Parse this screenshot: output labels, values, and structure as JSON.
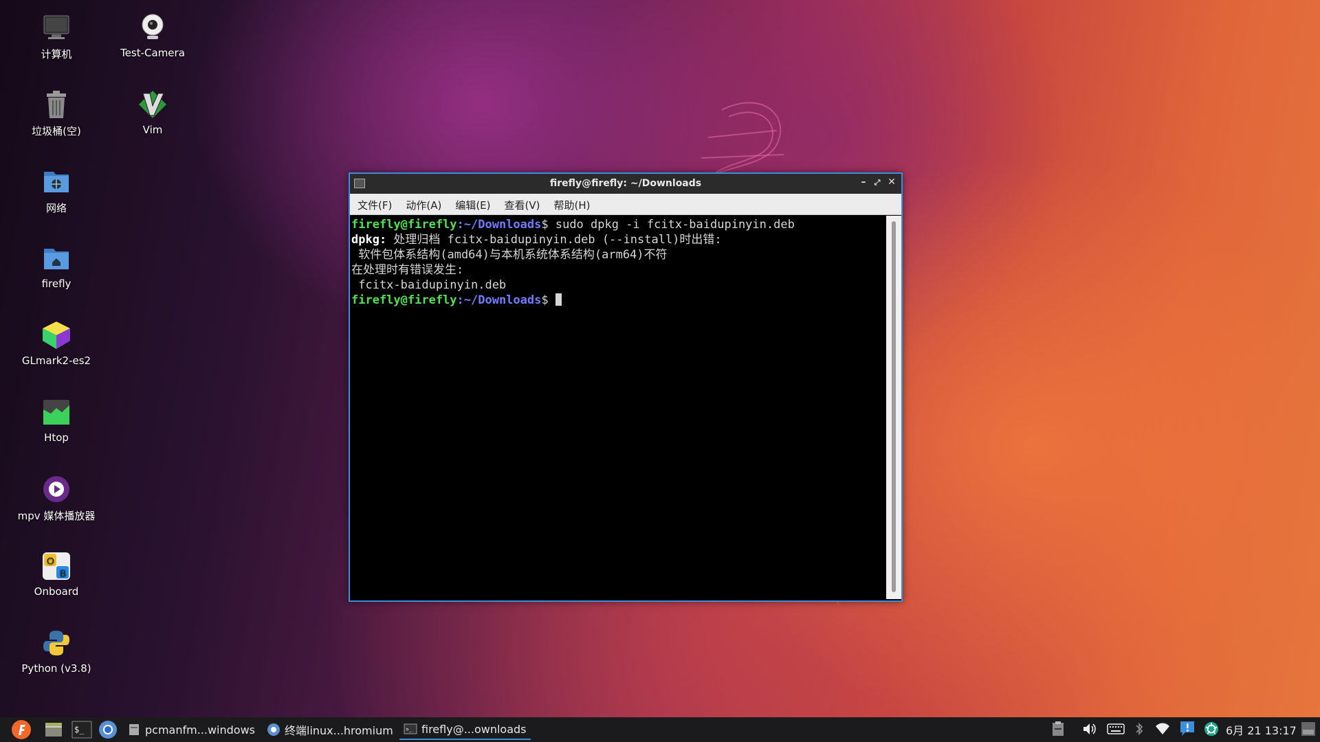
{
  "desktop": {
    "icons": [
      {
        "label": "计算机",
        "icon": "computer-icon"
      },
      {
        "label": "Test-Camera",
        "icon": "webcam-icon"
      },
      {
        "label": "垃圾桶(空)",
        "icon": "trash-icon"
      },
      {
        "label": "Vim",
        "icon": "vim-icon"
      },
      {
        "label": "网络",
        "icon": "network-folder-icon"
      },
      {
        "label": "firefly",
        "icon": "home-folder-icon"
      },
      {
        "label": "GLmark2-es2",
        "icon": "glmark-cube-icon"
      },
      {
        "label": "Htop",
        "icon": "htop-icon"
      },
      {
        "label": "mpv 媒体播放器",
        "icon": "mpv-icon"
      },
      {
        "label": "Onboard",
        "icon": "onboard-keyboard-icon"
      },
      {
        "label": "Python (v3.8)",
        "icon": "python-icon"
      }
    ]
  },
  "window": {
    "title": "firefly@firefly: ~/Downloads",
    "menu": [
      "文件(F)",
      "动作(A)",
      "编辑(E)",
      "查看(V)",
      "帮助(H)"
    ],
    "terminal": {
      "prompt_user": "firefly@firefly",
      "prompt_path": ":~/Downloads",
      "prompt_end": "$ ",
      "command": "sudo dpkg -i fcitx-baidupinyin.deb",
      "out1_label": "dpkg:",
      "out1_text": " 处理归档 fcitx-baidupinyin.deb (--install)时出错:",
      "out2": " 软件包体系结构(amd64)与本机系统体系结构(arm64)不符",
      "out3": "在处理时有错误发生:",
      "out4": " fcitx-baidupinyin.deb"
    }
  },
  "taskbar": {
    "tasks": [
      {
        "label": "pcmanfm...windows",
        "icon": "file-manager-icon"
      },
      {
        "label": "终端linux...hromium",
        "icon": "chromium-icon"
      },
      {
        "label": "firefly@...ownloads",
        "icon": "terminal-icon"
      }
    ],
    "clock": "6月 21 13:17"
  },
  "colors": {
    "accent": "#3c8fde",
    "prompt_green": "#4ee44e",
    "prompt_blue": "#6f7cff"
  }
}
